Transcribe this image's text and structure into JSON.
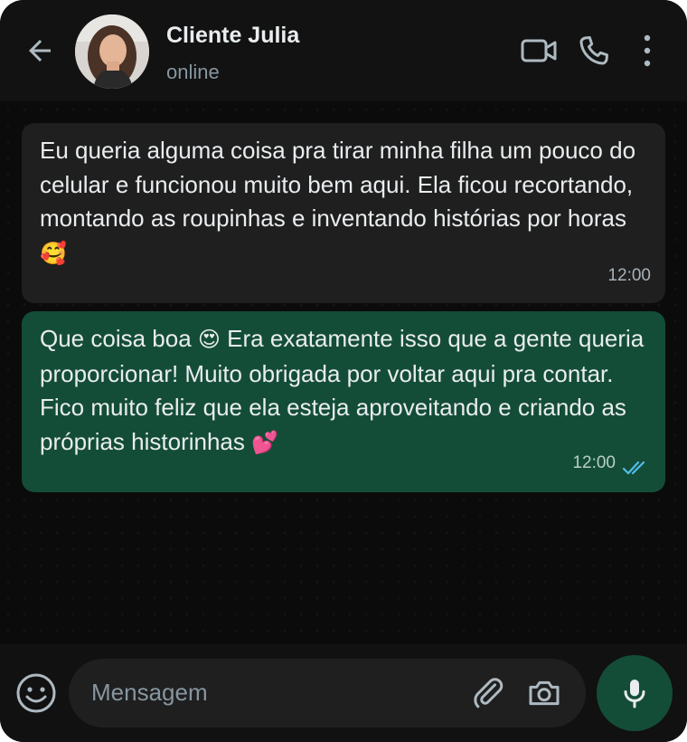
{
  "header": {
    "contact_name": "Cliente Julia",
    "status": "online",
    "icons": [
      "back-arrow-icon",
      "video-call-icon",
      "phone-icon",
      "more-options-icon"
    ]
  },
  "messages": [
    {
      "direction": "incoming",
      "text": "Eu queria alguma coisa pra tirar minha filha um pouco do celular e funcionou muito bem aqui. Ela ficou recortando, montando as roupinhas e inventando histórias por horas",
      "emoji": "🥰",
      "time": "12:00"
    },
    {
      "direction": "outgoing",
      "text_before_emoji": "Que coisa boa",
      "emoji_inline": "😍",
      "text_after_emoji": "Era exatamente isso que a gente queria proporcionar! Muito obrigada por voltar aqui pra contar. Fico muito feliz que ela esteja aproveitando e criando as próprias historinhas",
      "emoji": "💕",
      "time": "12:00",
      "read_status": "read"
    }
  ],
  "composer": {
    "placeholder": "Mensagem",
    "icons": [
      "emoji-icon",
      "attach-icon",
      "camera-icon",
      "mic-icon"
    ]
  },
  "colors": {
    "background": "#0b0b0b",
    "header": "#121212",
    "incoming_bubble": "#1f1f1f",
    "outgoing_bubble": "#144d37",
    "read_ticks": "#53bdeb",
    "icon_gray": "#aebac1"
  }
}
